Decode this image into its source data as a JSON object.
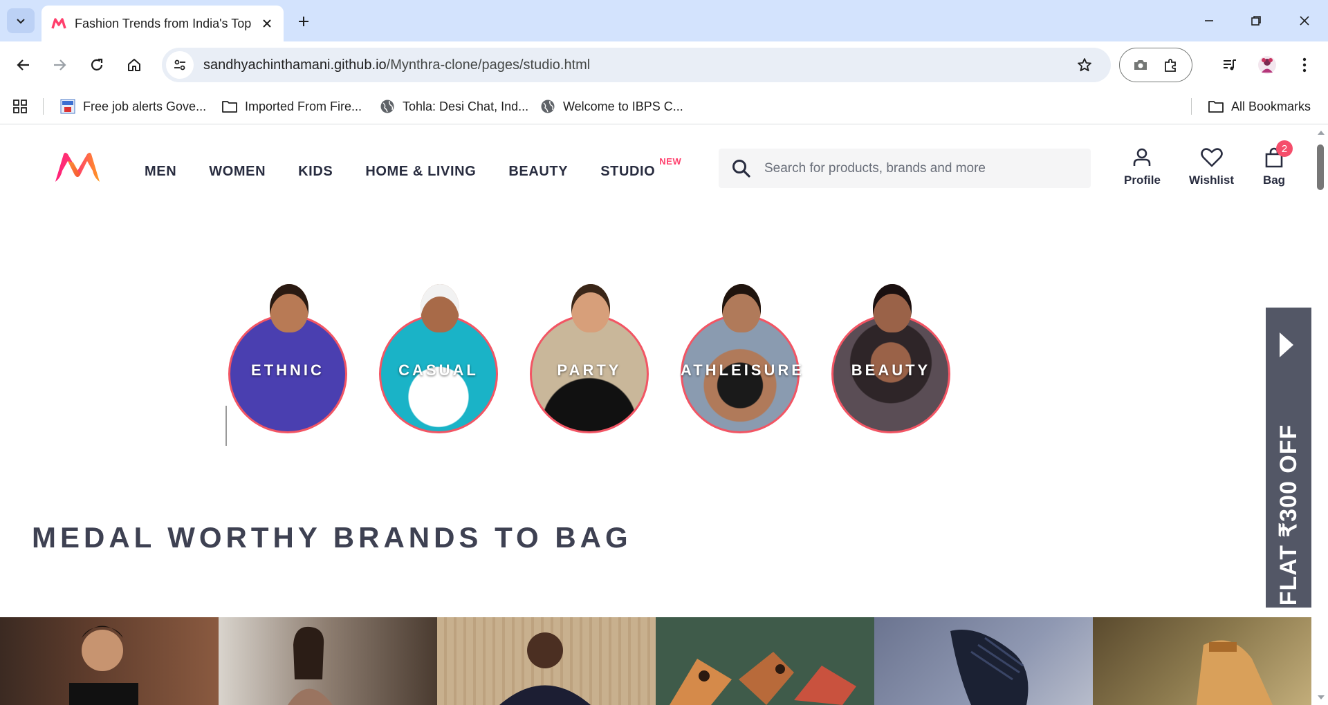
{
  "browser": {
    "tab_title": "Fashion Trends from India's Top",
    "url_host": "sandhyachinthamani.github.io",
    "url_path": "/Mynthra-clone/pages/studio.html",
    "bookmarks": [
      {
        "label": "Free job alerts Gove...",
        "icon": "jobs-favicon-icon"
      },
      {
        "label": "Imported From Fire...",
        "icon": "folder-icon"
      },
      {
        "label": "Tohla: Desi Chat, Ind...",
        "icon": "globe-icon"
      },
      {
        "label": "Welcome to IBPS C...",
        "icon": "globe-icon"
      }
    ],
    "all_bookmarks": "All Bookmarks"
  },
  "header": {
    "nav": [
      "MEN",
      "WOMEN",
      "KIDS",
      "HOME & LIVING",
      "BEAUTY",
      "STUDIO"
    ],
    "studio_badge": "NEW",
    "search_placeholder": "Search for products, brands and more",
    "actions": {
      "profile": "Profile",
      "wishlist": "Wishlist",
      "bag": "Bag",
      "bag_count": "2"
    }
  },
  "categories": [
    {
      "label": "ETHNIC",
      "bg": "#4a3fb0",
      "skin": "#b87a55"
    },
    {
      "label": "CASUAL",
      "bg": "#1ab3c7",
      "skin": "#a86a48"
    },
    {
      "label": "PARTY",
      "bg": "#c9b79a",
      "skin": "#d79f7a"
    },
    {
      "label": "ATHLEISURE",
      "bg": "#8a9bb0",
      "skin": "#b07a5a"
    },
    {
      "label": "BEAUTY",
      "bg": "#5a4d55",
      "skin": "#9a6248"
    }
  ],
  "offer": {
    "text": "FLAT ₹300 OFF"
  },
  "section": {
    "title": "MEDAL WORTHY BRANDS TO BAG"
  },
  "colors": {
    "accent": "#ff3f6c",
    "ring": "#f25564",
    "offer_bg": "#535766"
  }
}
